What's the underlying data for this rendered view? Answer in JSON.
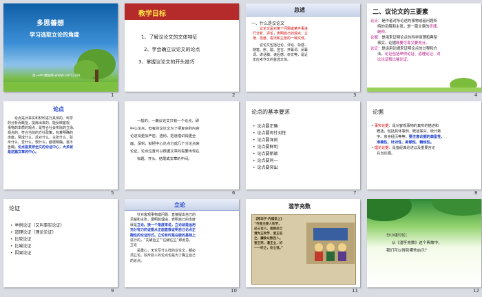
{
  "slides": [
    {
      "num": "1",
      "title1": "多思善想",
      "title2": "学习选取立论的角度",
      "footer": "第一PPT模板网-WWW.1PPT.COM"
    },
    {
      "num": "2",
      "title": "教学目标",
      "items": [
        "1、了解议论文的文体特征",
        "2、学会确立议论文的论点",
        "3、掌握议论文的开头技巧"
      ]
    },
    {
      "num": "3",
      "title": "总述",
      "subtitle": "一、什么是议论文",
      "p1_lines": [
        "议论文是对某个问题或某件事进",
        "行分析、评论，表明自己的观点、立",
        "场、态度、看法和主张的一种文体。"
      ],
      "p2_lines": [
        "议论文包括社论、评论、杂感、",
        "随笔、序、跋、宣言、开幕词、闭幕",
        "词、讲话稿、读后感、杂文等，是近",
        "年应考作文的首选文体。"
      ]
    },
    {
      "num": "4",
      "title": "二、议论文的三要素",
      "lines": [
        [
          "论点",
          "：是作者对所论述的事物或者问题所"
        ],
        [
          "",
          "持的见解和主张。是一篇文章的",
          "灵魂、"
        ],
        [
          "",
          "统帅。"
        ],
        [
          "论据",
          "：是用来证明论点的科学原理和典型"
        ],
        [
          "",
          "事实。论据",
          "既要可靠又要充分。"
        ],
        [
          "论证",
          "：是运用论据来证明论点的过程和方"
        ],
        [
          "",
          "法。",
          "论证包括举例论证、道理论证、对"
        ],
        [
          "",
          "比论证和比喻论证。"
        ]
      ]
    },
    {
      "num": "5",
      "title": "论点",
      "lines": [
        "论点是对事实和材料进行具体的、科学",
        "的分析而概括，提炼出来的，能反映客观",
        "事物的本质的观点，是符合社会实际的立场、",
        "观点的，符合当前的方针政策，有着明确的",
        "态度，赞成什么，反对什么，主张什么，驳",
        "斥什么，爱什么，恨什么，都很明确，毫不",
        "含糊。"
      ],
      "highlight1": "论点是贯穿全文的论证中心，大多就",
      "highlight2": "是这篇文章的中心。"
    },
    {
      "num": "6",
      "lines": [
        "一般的，一篇议论文只有一个论点，即",
        "中心论点，但有的议论文为了把复杂的内容",
        "论述得更加严密、透彻，把道理讲得更全",
        "面、深刻，就把中心论点分成几个分论点来",
        "论证。论点位置可以根据文章的需要出现在",
        "标题、开头、结尾或文章的中间。"
      ]
    },
    {
      "num": "7",
      "title": "论点的基本要求",
      "items": [
        "论点要正确",
        "论点要有针对性",
        "论点要深刻",
        "论点要鲜明",
        "论点要新颖",
        "论点要同一",
        "论点要突出"
      ]
    },
    {
      "num": "8",
      "title": "论据",
      "lines": [
        [
          "事实论据",
          "：是对客观事物的真实的描述和"
        ],
        [
          "",
          "概括，包括具体事例、概括事实、统计数"
        ],
        [
          "",
          "字、亲身经历等等。",
          "要注意论据的典型性、"
        ],
        [
          "",
          "准确性、针对性、新颖性、精炼性。"
        ],
        [
          "理论论据",
          "：是指经典论述以及重要言论"
        ],
        [
          "",
          "充当论据。"
        ]
      ]
    },
    {
      "num": "9",
      "title": "论证",
      "items": [
        "举例论证（又叫事实论证）",
        "道理论证（理论论证）",
        "比较论证",
        "比喻论证",
        "因果论证"
      ]
    },
    {
      "num": "10",
      "title": "立论",
      "lines": [
        "针对客观事物或问题，直接提出自己的",
        "见解和主张，阐明其理由，表明自己的态度",
        "就是",
        "立论。换一个角度来说，立论就是运用",
        "充分有力的证据从正面直接证明自己论点正",
        "确性的论证形式。立论有时是在破的基础上",
        "进行的，“先破后立”“边破边立”即此意。",
        "立论",
        "是重心，无论写什么样的议论文，都必",
        "须立论。驳斥别人的论点也是为了确立自己",
        "的论点。"
      ]
    },
    {
      "num": "11",
      "title": "滥竽充数",
      "story": [
        "《韩非子·内储说上》",
        "“齐宣王使人吹竽，",
        "必三百人。南郭处士",
        "请为王吹竽，宣王说",
        "之，廪食以数百人。",
        "宣王死，湣王立，好",
        "一一听之，处士逃。”"
      ]
    },
    {
      "num": "12",
      "lines": [
        "分小组讨论：",
        "从《滥竽充数》这个典故中，",
        "我们可以得到哪些启示？"
      ]
    }
  ]
}
